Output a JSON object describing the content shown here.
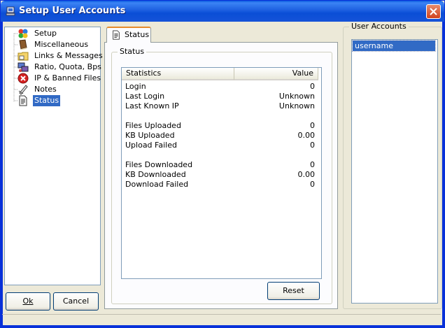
{
  "window": {
    "title": "Setup User Accounts",
    "accent": "#0a5ae0"
  },
  "tree": {
    "items": [
      {
        "label": "Setup",
        "icon": "setup-icon"
      },
      {
        "label": "Miscellaneous",
        "icon": "book-icon"
      },
      {
        "label": "Links & Messages",
        "icon": "folder-icon"
      },
      {
        "label": "Ratio, Quota, Bps",
        "icon": "network-icon"
      },
      {
        "label": "IP & Banned Files",
        "icon": "banned-icon"
      },
      {
        "label": "Notes",
        "icon": "notes-icon"
      },
      {
        "label": "Status",
        "icon": "document-icon",
        "selected": true
      }
    ]
  },
  "buttons": {
    "ok": "Ok",
    "cancel": "Cancel",
    "reset": "Reset"
  },
  "tab": {
    "label": "Status"
  },
  "status_group": {
    "label": "Status",
    "columns": [
      "Statistics",
      "Value"
    ],
    "rows": [
      {
        "key": "Login",
        "value": "0"
      },
      {
        "key": "Last Login",
        "value": "Unknown"
      },
      {
        "key": "Last Known IP",
        "value": "Unknown"
      },
      {
        "key": "Files Uploaded",
        "value": "0"
      },
      {
        "key": "KB Uploaded",
        "value": "0.00"
      },
      {
        "key": "Upload Failed",
        "value": "0"
      },
      {
        "key": "Files Downloaded",
        "value": "0"
      },
      {
        "key": "KB Downloaded",
        "value": "0.00"
      },
      {
        "key": "Download Failed",
        "value": "0"
      }
    ]
  },
  "user_accounts": {
    "label": "User Accounts",
    "items": [
      "username"
    ],
    "selection_color": "#316ac5"
  }
}
